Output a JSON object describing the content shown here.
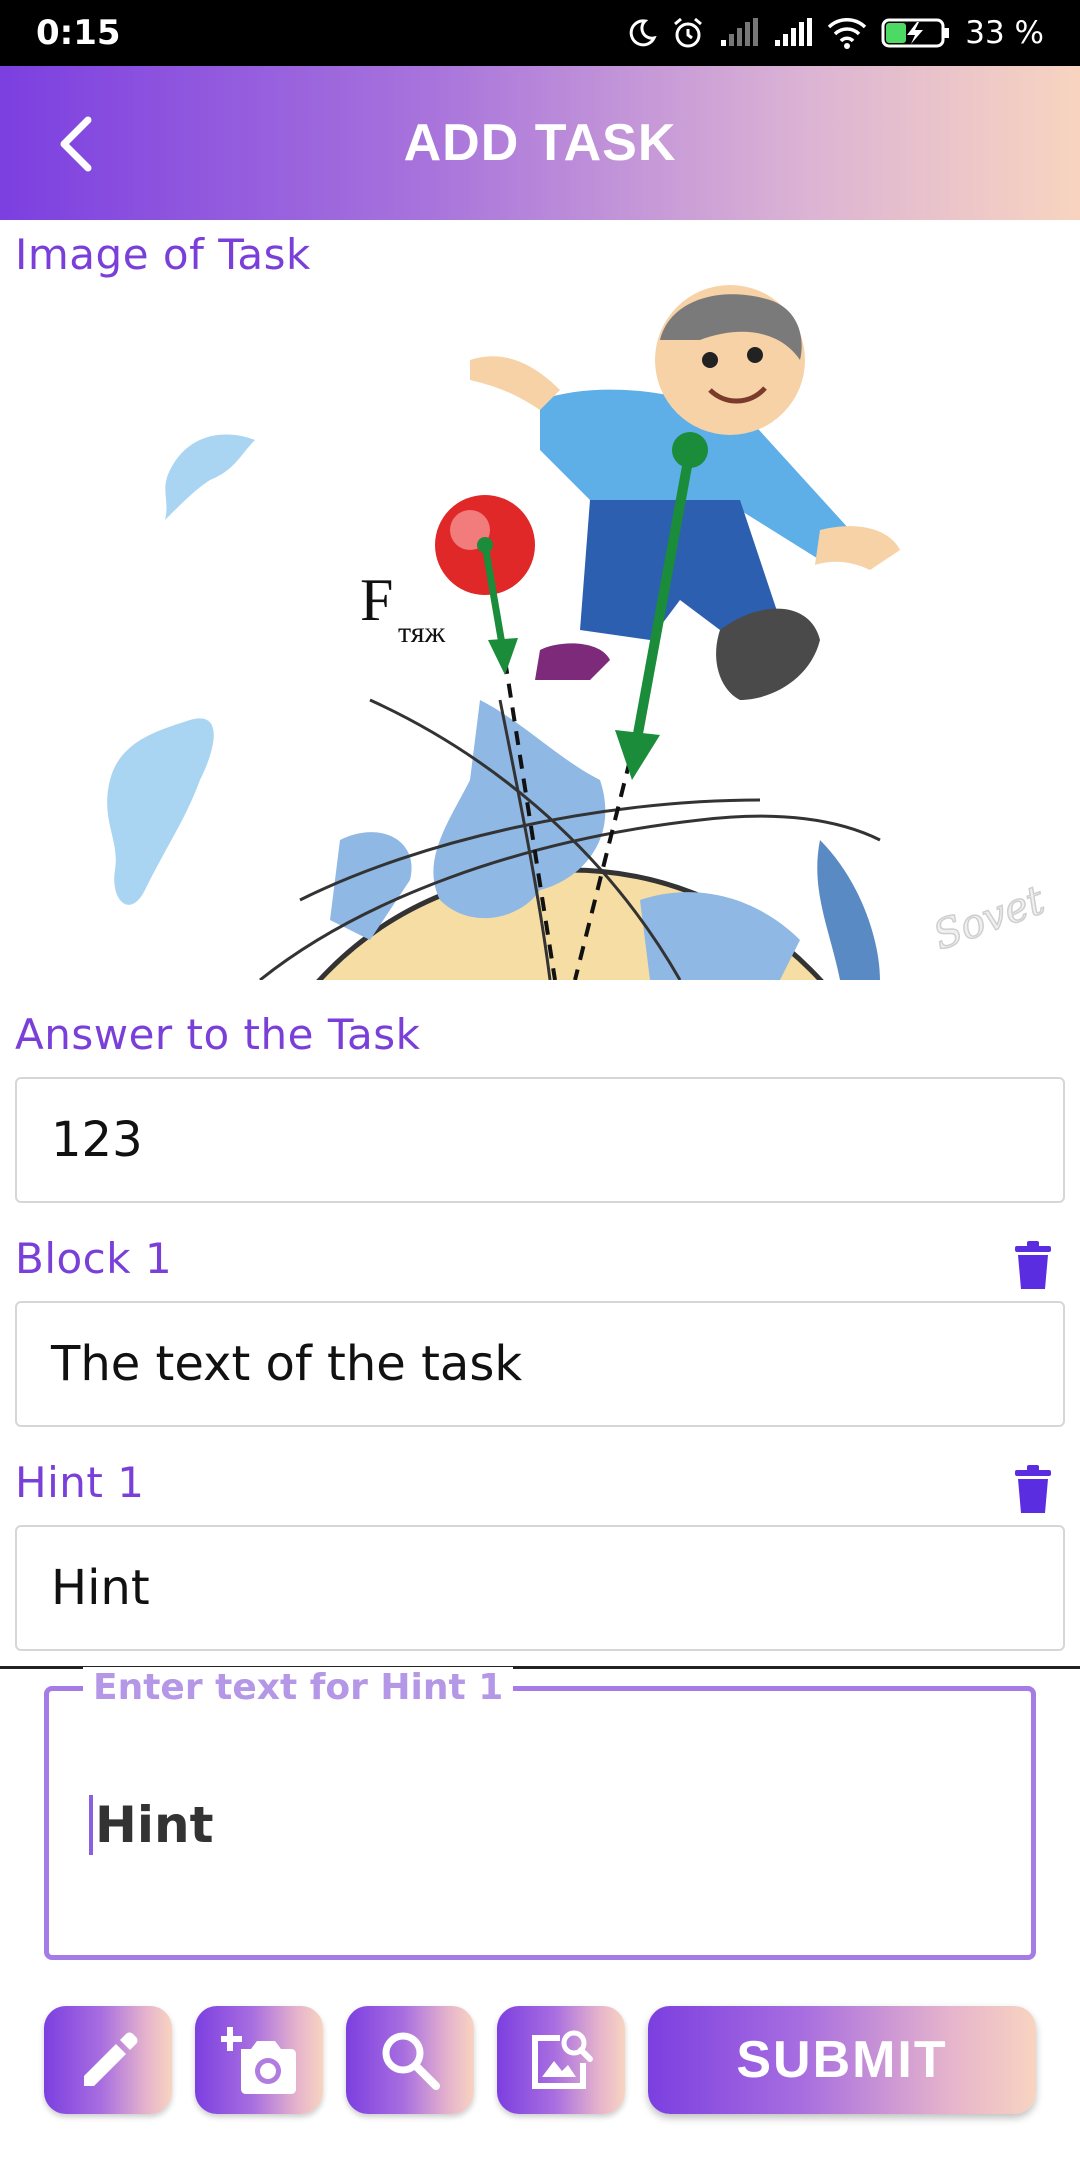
{
  "status_bar": {
    "time": "0:15",
    "battery": "33 %"
  },
  "app_bar": {
    "title": "ADD TASK",
    "back_icon": "chevron-left-icon"
  },
  "image_section": {
    "label": "Image of Task",
    "image_caption": "Fтяж",
    "watermark": "Sovet"
  },
  "answer": {
    "label": "Answer to the Task",
    "value": "123"
  },
  "blocks": [
    {
      "label": "Block 1",
      "value": "The text of the task",
      "delete_icon": "trash-icon"
    }
  ],
  "hints": [
    {
      "label": "Hint 1",
      "value": "Hint",
      "delete_icon": "trash-icon"
    }
  ],
  "hint_editor": {
    "legend": "Enter text for Hint 1",
    "value": "Hint"
  },
  "toolbar": {
    "tools": [
      "pencil-icon",
      "add-photo-icon",
      "search-icon",
      "image-search-icon"
    ],
    "submit_label": "SUBMIT"
  },
  "colors": {
    "accent": "#7a3fd8",
    "trash": "#5a2ee0",
    "gradient_start": "#7c3fe0",
    "gradient_end": "#f8d4c0"
  }
}
